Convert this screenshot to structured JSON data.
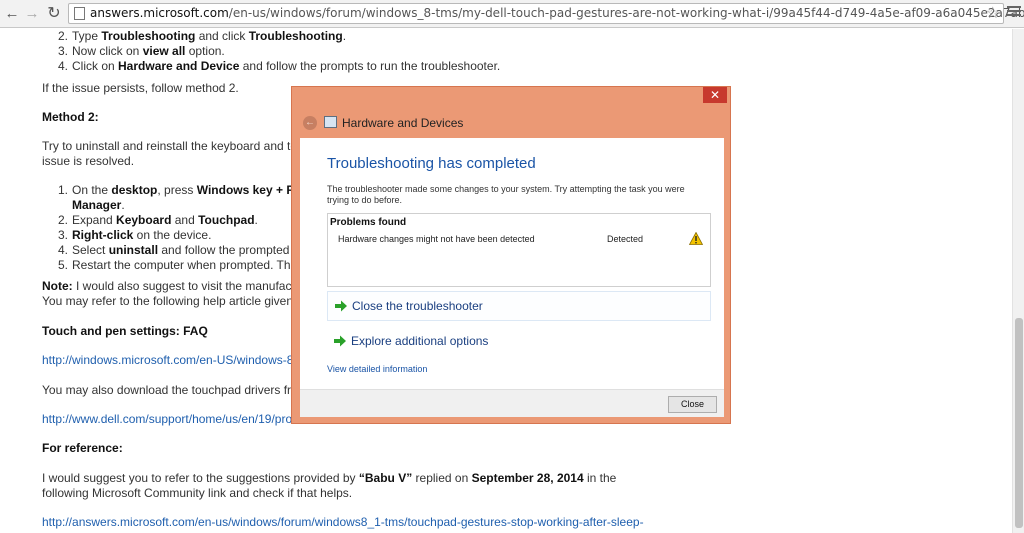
{
  "browser": {
    "url_host": "answers.microsoft.com",
    "url_path": "/en-us/windows/forum/windows_8-tms/my-dell-touch-pad-gestures-are-not-working-what-i/99a45f44-d749-4a5e-af09-a6a045e2a7ab"
  },
  "article": {
    "step2": {
      "num": "2.",
      "a": "Type ",
      "b": "Troubleshooting",
      "c": " and click ",
      "d": "Troubleshooting",
      "e": "."
    },
    "step3": {
      "num": "3.",
      "a": "Now click on ",
      "b": "view all",
      "c": " option."
    },
    "step4": {
      "num": "4.",
      "a": "Click on ",
      "b": "Hardware and Device",
      "c": " and follow the prompts to run the troubleshooter."
    },
    "persist": "If the issue persists, follow method 2.",
    "method2": "Method 2:",
    "try1": "Try to uninstall and reinstall the keyboard and touc",
    "try2": "issue is resolved.",
    "m2s1": {
      "num": "1.",
      "a": "On the ",
      "b": "desktop",
      "c": ", press ",
      "d": "Windows key + R",
      "e": " ar"
    },
    "m2s1b": "Manager",
    "m2s2": {
      "num": "2.",
      "a": "Expand ",
      "b": "Keyboard",
      "c": " and ",
      "d": "Touchpad",
      "e": "."
    },
    "m2s3": {
      "num": "3.",
      "b": "Right-click",
      "c": " on the device."
    },
    "m2s4": {
      "num": "4.",
      "a": "Select ",
      "b": "uninstall",
      "c": " and follow the prompted ste"
    },
    "m2s5": {
      "num": "5.",
      "a": "Restart the computer when prompted. This w"
    },
    "note_label": "Note:",
    "note_text": " I would also suggest to visit the manufactur",
    "refer": "You may refer to the following help article given b",
    "touch_heading": "Touch and pen settings: FAQ",
    "link1": "http://windows.microsoft.com/en-US/windows-8/t",
    "download": "You may also download the touchpad drivers from",
    "link2": "http://www.dell.com/support/home/us/en/19/proc",
    "for_ref": "For reference:",
    "suggest_a": "I would suggest you to refer to the suggestions provided by ",
    "suggest_b": "“Babu V”",
    "suggest_c": " replied on ",
    "suggest_d": "September 28, 2014",
    "suggest_e": " in the",
    "suggest2": "following Microsoft Community link and check if that helps.",
    "link3": "http://answers.microsoft.com/en-us/windows/forum/windows8_1-tms/touchpad-gestures-stop-working-after-sleep-"
  },
  "dialog": {
    "close_glyph": "✕",
    "title": "Hardware and Devices",
    "heading": "Troubleshooting has completed",
    "description": "The troubleshooter made some changes to your system. Try attempting the task you were trying to do before.",
    "problems_header": "Problems found",
    "problem_text": "Hardware changes might not have been detected",
    "problem_status": "Detected",
    "option_close": "Close the troubleshooter",
    "option_explore": "Explore additional options",
    "detail_link": "View detailed information",
    "close_button": "Close",
    "accent": "#eb9975",
    "link_color": "#1a54a6"
  }
}
